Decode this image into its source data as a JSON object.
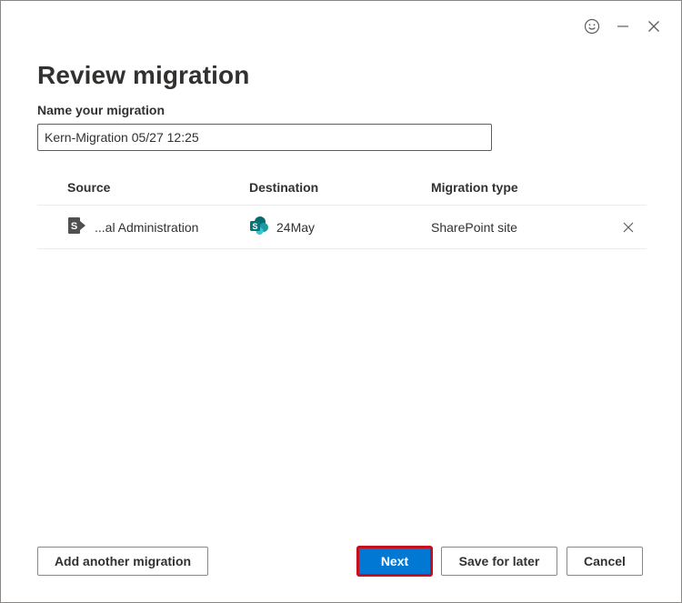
{
  "window": {
    "title": "Review migration",
    "controls": {
      "feedback_icon": "smiley-icon",
      "minimize_icon": "minimize-icon",
      "close_icon": "close-icon"
    }
  },
  "form": {
    "name_label": "Name your migration",
    "name_value": "Kern-Migration 05/27 12:25"
  },
  "table": {
    "headers": {
      "source": "Source",
      "destination": "Destination",
      "type": "Migration type"
    },
    "rows": [
      {
        "source": "...al Administration",
        "destination": "24May",
        "type": "SharePoint site"
      }
    ]
  },
  "footer": {
    "add_label": "Add another migration",
    "next_label": "Next",
    "save_label": "Save for later",
    "cancel_label": "Cancel"
  },
  "colors": {
    "primary": "#0078d4",
    "highlight_border": "#c50f1f",
    "sharepoint_teal": "#036c70"
  }
}
